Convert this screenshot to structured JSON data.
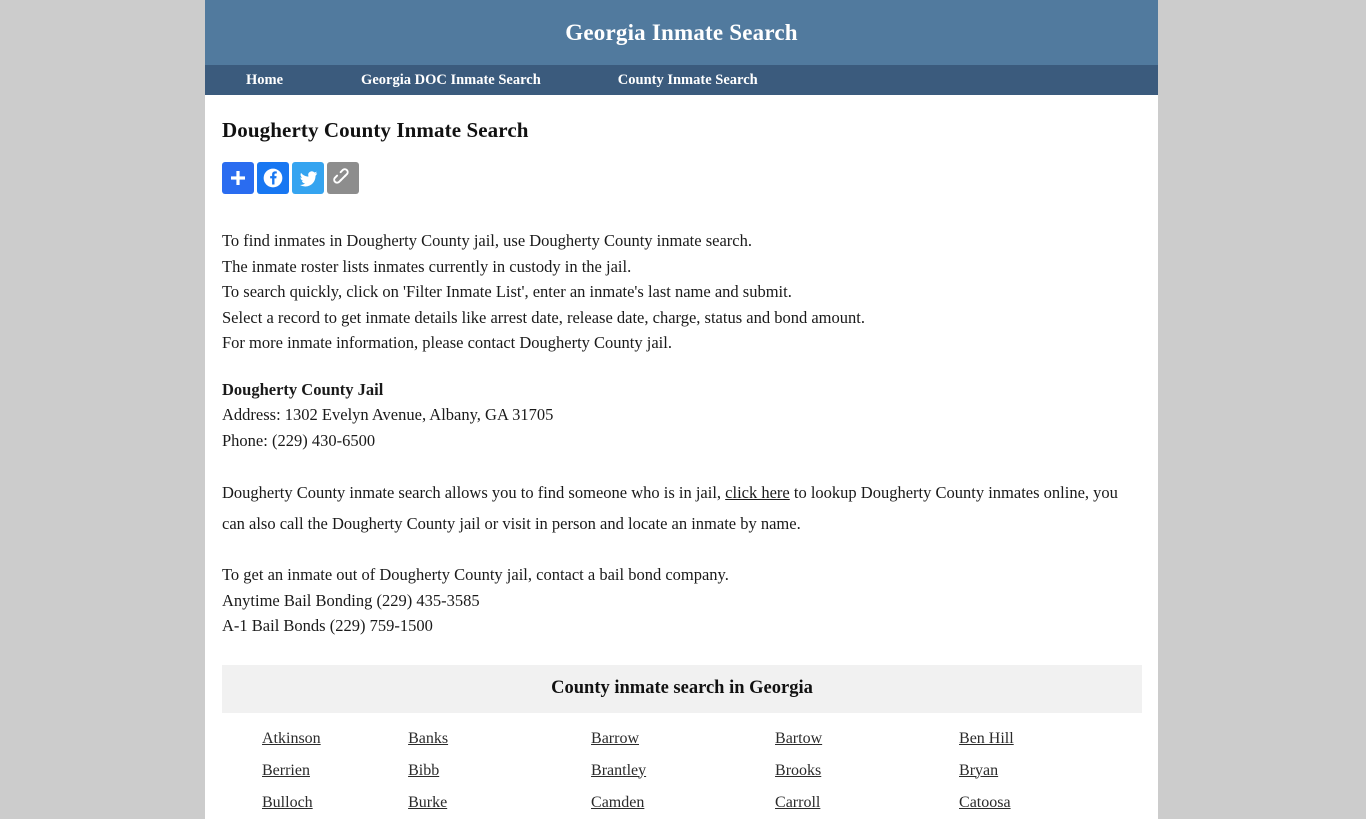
{
  "site": {
    "title": "Georgia Inmate Search",
    "header_bg": "#517a9e",
    "nav_bg": "#3b5b7d",
    "page_bg": "#cccccc"
  },
  "nav": {
    "items": [
      {
        "label": "Home"
      },
      {
        "label": "Georgia DOC Inmate Search"
      },
      {
        "label": "County Inmate Search"
      }
    ]
  },
  "main": {
    "page_title": "Dougherty County Inmate Search",
    "share": {
      "buttons": [
        {
          "name": "addthis-share-icon",
          "label": "Share",
          "color": "#2a6cf0"
        },
        {
          "name": "facebook-icon",
          "label": "Facebook",
          "color": "#1877f2"
        },
        {
          "name": "twitter-icon",
          "label": "Twitter",
          "color": "#35a4f0"
        },
        {
          "name": "copy-link-icon",
          "label": "Copy Link",
          "color": "#8d8d8d"
        }
      ]
    },
    "intro_lines": [
      "To find inmates in Dougherty County jail, use Dougherty County inmate search.",
      "The inmate roster lists inmates currently in custody in the jail.",
      "To search quickly, click on 'Filter Inmate List', enter an inmate's last name and submit.",
      "Select a record to get inmate details like arrest date, release date, charge, status and bond amount.",
      "For more inmate information, please contact Dougherty County jail."
    ],
    "jail": {
      "name": "Dougherty County Jail",
      "address": "Address: 1302 Evelyn Avenue, Albany, GA 31705",
      "phone": "Phone: (229) 430-6500"
    },
    "search_paragraph": {
      "before_link": "Dougherty County inmate search allows you to find someone who is in jail, ",
      "link_text": "click here",
      "after_link": " to lookup Dougherty County inmates online, you can also call the Dougherty County jail or visit in person and locate an inmate by name."
    },
    "bail_lines": [
      "To get an inmate out of Dougherty County jail, contact a bail bond company.",
      "Anytime Bail Bonding (229) 435-3585",
      "A-1 Bail Bonds (229) 759-1500"
    ]
  },
  "county_table": {
    "header": "County inmate search in Georgia",
    "rows": [
      [
        "Atkinson",
        "Banks",
        "Barrow",
        "Bartow",
        "Ben Hill"
      ],
      [
        "Berrien",
        "Bibb",
        "Brantley",
        "Brooks",
        "Bryan"
      ],
      [
        "Bulloch",
        "Burke",
        "Camden",
        "Carroll",
        "Catoosa"
      ]
    ]
  }
}
